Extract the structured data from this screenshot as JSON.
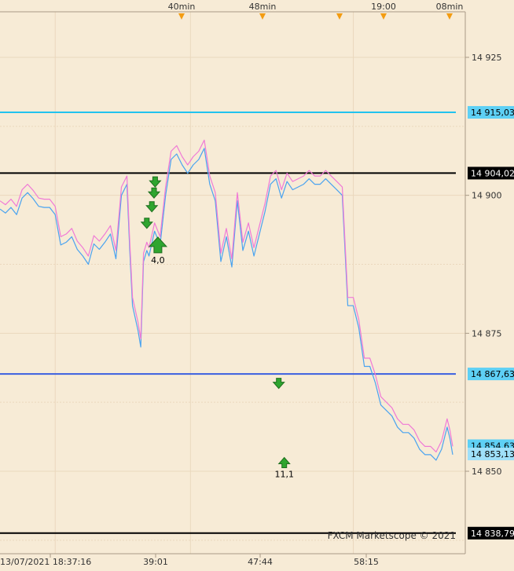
{
  "watermark": "FXCM Marketscope © 2021",
  "colors": {
    "background": "#f7ebd6",
    "grid": "#ead8bd",
    "bid_line": "#4aa3f0",
    "ask_line": "#f07ad6",
    "level_cyan": "#22c3ee",
    "level_blue": "#3a5fe0",
    "level_black": "#000000",
    "marker_green": "#2fa52f",
    "price_label_cyan": "#5ed0f5",
    "price_label_light": "#9fe0fa",
    "price_label_black": "#000000"
  },
  "time_axis": {
    "top_labels": [
      "40min",
      "48min",
      "19:00",
      "08min"
    ],
    "bottom_labels": [
      "13/07/2021 18:37:16",
      "39:01",
      "47:44",
      "58:15"
    ]
  },
  "chart_data": {
    "type": "line",
    "title": "",
    "xlabel": "",
    "ylabel": "",
    "ylim": [
      14835,
      14935
    ],
    "y_ticks": [
      "14 925",
      "14 900",
      "14 875",
      "14 850"
    ],
    "x_tick_values": [
      10,
      34.5,
      64
    ],
    "x_range": [
      0,
      84
    ],
    "grid": true,
    "horizontal_levels": [
      {
        "value": 14915.03,
        "label": "14 915,03",
        "color_key": "level_cyan",
        "label_color_key": "price_label_cyan",
        "text_color": "#000000"
      },
      {
        "value": 14904.02,
        "label": "14 904,02",
        "color_key": "level_black",
        "label_color_key": "price_label_black",
        "text_color": "#ffffff"
      },
      {
        "value": 14867.63,
        "label": "14 867,63",
        "color_key": "level_blue",
        "label_color_key": "price_label_cyan",
        "text_color": "#000000"
      },
      {
        "value": 14838.79,
        "label": "14 838,79",
        "color_key": "level_black",
        "label_color_key": "price_label_black",
        "text_color": "#ffffff"
      }
    ],
    "current_price_labels": [
      {
        "value": 14854.63,
        "label": "14 854,63",
        "label_color_key": "price_label_cyan"
      },
      {
        "value": 14853.13,
        "label": "14 853,13",
        "label_color_key": "price_label_light"
      }
    ],
    "x": [
      0.0,
      1.0,
      2.0,
      3.0,
      4.0,
      5.0,
      6.0,
      7.0,
      8.0,
      9.0,
      10.0,
      11.0,
      12.0,
      13.0,
      14.0,
      15.0,
      16.0,
      17.0,
      18.0,
      19.0,
      20.0,
      21.0,
      22.0,
      23.0,
      23.5,
      24.0,
      25.0,
      25.5,
      26.0,
      26.6,
      27.0,
      28.0,
      29.0,
      30.0,
      31.0,
      32.0,
      33.0,
      34.0,
      35.0,
      36.0,
      37.0,
      38.0,
      39.0,
      40.0,
      41.0,
      42.0,
      43.0,
      44.0,
      45.0,
      46.0,
      47.0,
      48.0,
      49.0,
      50.0,
      51.0,
      52.0,
      53.0,
      54.0,
      55.0,
      56.0,
      57.0,
      58.0,
      59.0,
      60.0,
      61.0,
      62.0,
      63.0,
      64.0,
      65.0,
      66.0,
      67.0,
      68.0,
      69.0,
      70.0,
      71.0,
      72.0,
      73.0,
      74.0,
      75.0,
      76.0,
      77.0,
      78.0,
      79.0,
      80.0,
      81.0,
      81.5,
      82.0
    ],
    "series": [
      {
        "color_key": "bid_line",
        "values": [
          14897.5,
          14896.8,
          14897.8,
          14896.5,
          14899.5,
          14900.5,
          14899.4,
          14898.0,
          14897.8,
          14897.8,
          14896.5,
          14891.0,
          14891.5,
          14892.5,
          14890.2,
          14889.0,
          14887.5,
          14891.2,
          14890.2,
          14891.5,
          14893.0,
          14888.5,
          14900.0,
          14902.0,
          14890.0,
          14880.0,
          14875.5,
          14872.5,
          14888.0,
          14890.0,
          14889.0,
          14893.5,
          14891.0,
          14900.0,
          14906.5,
          14907.5,
          14905.5,
          14904.0,
          14905.5,
          14906.5,
          14908.5,
          14902.0,
          14899.0,
          14888.0,
          14892.5,
          14887.0,
          14899.0,
          14890.0,
          14893.5,
          14889.0,
          14893.0,
          14897.0,
          14902.0,
          14903.0,
          14899.5,
          14902.5,
          14901.0,
          14901.5,
          14902.0,
          14903.0,
          14902.0,
          14902.0,
          14903.0,
          14902.0,
          14901.0,
          14900.0,
          14880.0,
          14880.0,
          14876.0,
          14869.0,
          14869.0,
          14866.0,
          14862.0,
          14861.0,
          14860.0,
          14858.0,
          14857.0,
          14857.0,
          14856.0,
          14854.0,
          14853.0,
          14853.0,
          14852.0,
          14854.0,
          14858.0,
          14856.0,
          14853.0
        ]
      },
      {
        "color_key": "ask_line",
        "values": [
          14899.0,
          14898.3,
          14899.3,
          14898.0,
          14901.0,
          14902.0,
          14900.9,
          14899.5,
          14899.3,
          14899.3,
          14898.0,
          14892.5,
          14893.0,
          14894.0,
          14891.7,
          14890.5,
          14889.0,
          14892.7,
          14891.7,
          14893.0,
          14894.5,
          14890.0,
          14901.5,
          14903.5,
          14891.5,
          14881.5,
          14877.0,
          14874.0,
          14889.5,
          14891.5,
          14890.5,
          14895.0,
          14892.5,
          14901.5,
          14908.0,
          14909.0,
          14907.0,
          14905.5,
          14907.0,
          14908.0,
          14910.0,
          14903.5,
          14900.5,
          14889.5,
          14894.0,
          14888.5,
          14900.5,
          14891.5,
          14895.0,
          14890.5,
          14894.5,
          14898.5,
          14903.5,
          14904.5,
          14901.0,
          14904.0,
          14902.5,
          14903.0,
          14903.5,
          14904.5,
          14903.5,
          14903.5,
          14904.5,
          14903.5,
          14902.5,
          14901.5,
          14881.5,
          14881.5,
          14877.5,
          14870.5,
          14870.5,
          14867.5,
          14863.5,
          14862.5,
          14861.5,
          14859.5,
          14858.5,
          14858.5,
          14857.5,
          14855.5,
          14854.5,
          14854.5,
          14853.5,
          14855.5,
          14859.5,
          14857.5,
          14854.5
        ]
      }
    ],
    "markers": [
      {
        "type": "arrow-down-small",
        "x": 28.1,
        "y": 14902.5
      },
      {
        "type": "arrow-down-small",
        "x": 27.9,
        "y": 14900.5
      },
      {
        "type": "arrow-down-small",
        "x": 27.5,
        "y": 14898.0
      },
      {
        "type": "arrow-down-small",
        "x": 26.6,
        "y": 14895.0
      },
      {
        "type": "arrow-up-large",
        "x": 28.6,
        "y": 14891.0,
        "label": "4,0"
      },
      {
        "type": "arrow-down-small",
        "x": 50.5,
        "y": 14866.0
      },
      {
        "type": "arrow-up-small",
        "x": 51.5,
        "y": 14851.5,
        "label": "11,1"
      }
    ]
  }
}
